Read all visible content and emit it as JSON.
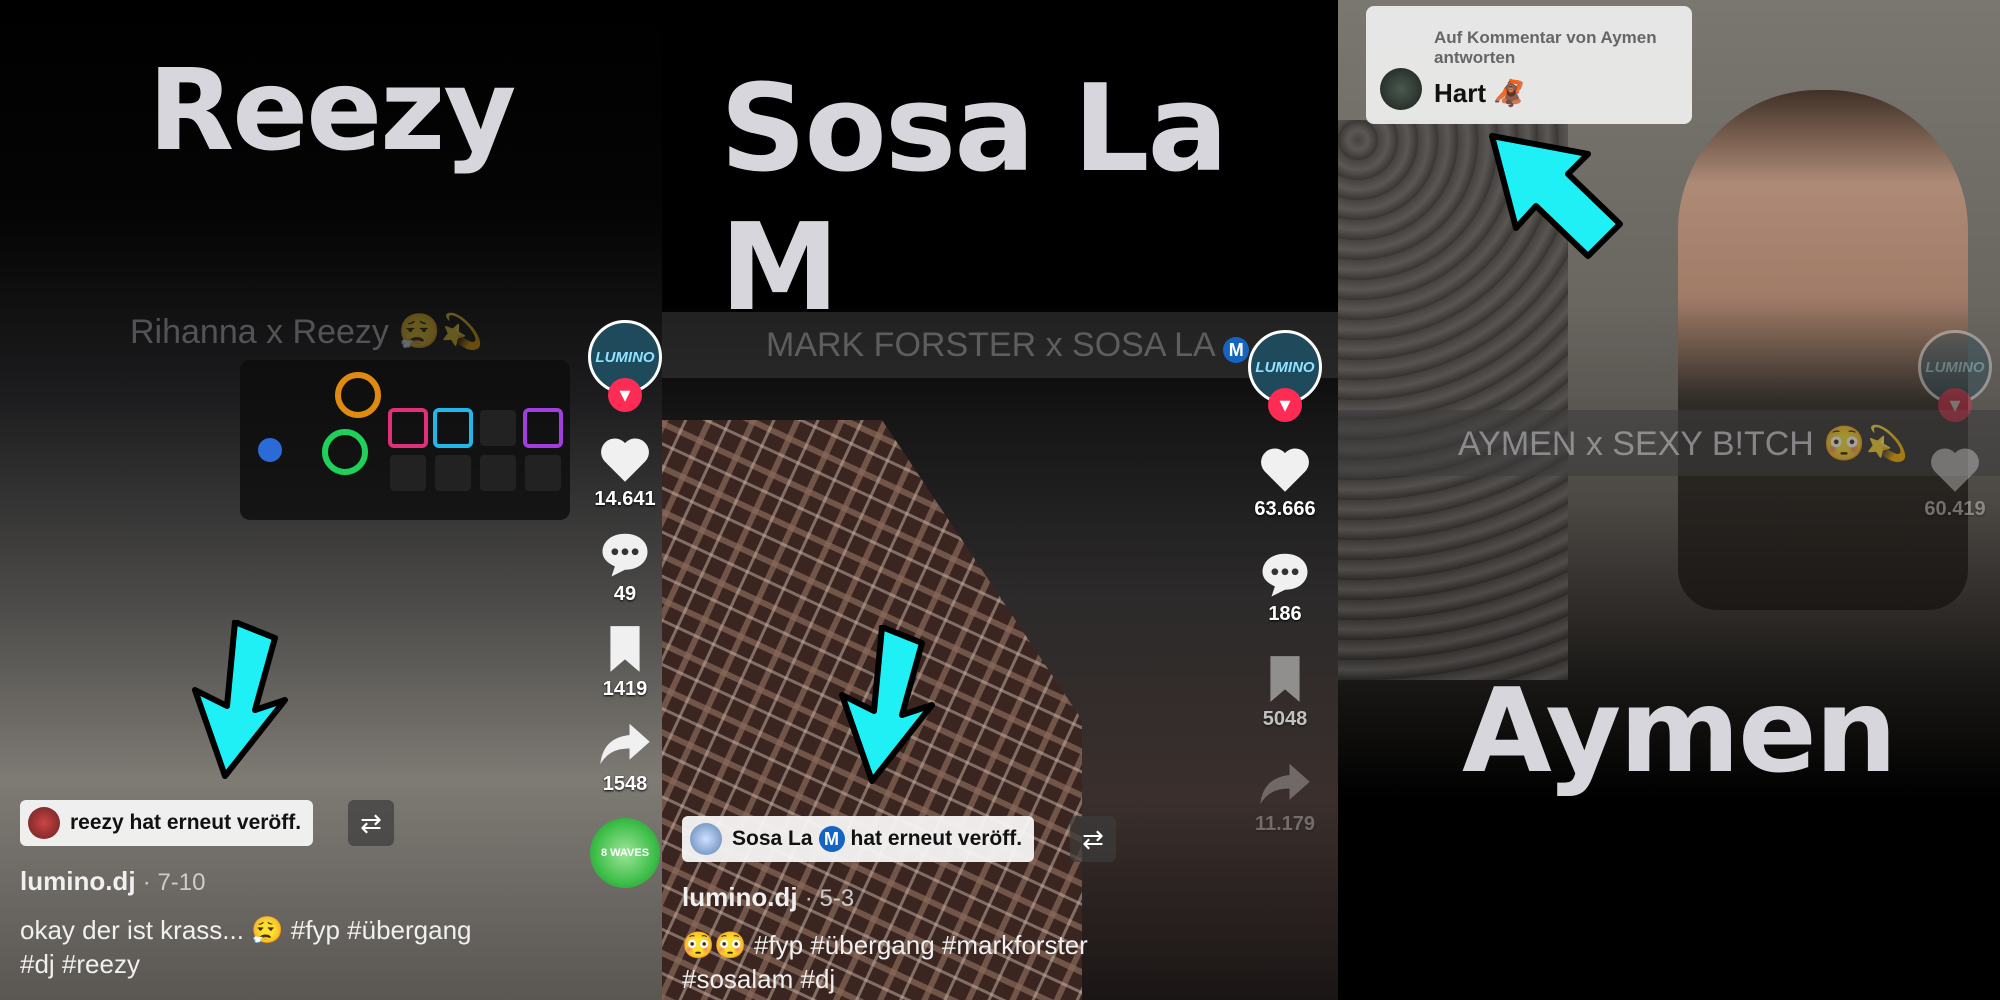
{
  "panels": [
    {
      "heading": "Reezy",
      "overlay_title": "Rihanna x Reezy 😮‍💨💫",
      "rail": {
        "likes": "14.641",
        "comments": "49",
        "saves": "1419",
        "shares": "1548",
        "brand": "LUMINO"
      },
      "repost_chip": "reezy hat erneut veröff.",
      "author": "lumino.dj",
      "date": "· 7-10",
      "caption_line1": "okay der ist krass... 😮‍💨 #fyp #übergang",
      "caption_line2": "#dj #reezy",
      "sound_label": "8 WAVES"
    },
    {
      "heading": "Sosa La M",
      "overlay_title": "MARK FORSTER x SOSA LA",
      "rail": {
        "likes": "63.666",
        "comments": "186",
        "saves": "5048",
        "shares": "11.179",
        "brand": "LUMINO"
      },
      "repost_chip_a": "Sosa La",
      "repost_chip_b": "hat erneut veröff.",
      "author": "lumino.dj",
      "date": "· 5-3",
      "caption_line1": "😳😳 #fyp #übergang #markforster",
      "caption_line2": "#sosalam #dj"
    },
    {
      "heading": "Aymen",
      "overlay_title": "AYMEN x SEXY B!TCH 😳💫",
      "rail": {
        "likes": "60.419",
        "brand": "LUMINO"
      },
      "reply_label_1": "Auf Kommentar von Aymen",
      "reply_label_2": "antworten",
      "reply_text": "Hart 🦧"
    }
  ],
  "m_badge": "M",
  "colors": {
    "arrow": "#1ff0f5",
    "like_red": "#fe2c55"
  }
}
